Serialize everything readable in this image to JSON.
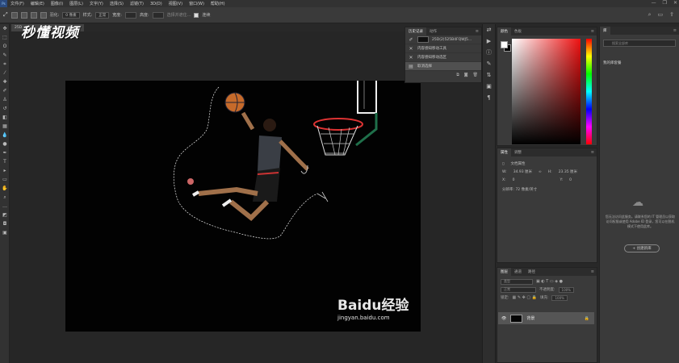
{
  "menubar": {
    "app_icon": "Ps",
    "items": [
      "文件(F)",
      "编辑(E)",
      "图像(I)",
      "图层(L)",
      "文字(Y)",
      "选择(S)",
      "滤镜(T)",
      "3D(D)",
      "视图(V)",
      "窗口(W)",
      "帮助(H)"
    ]
  },
  "options": {
    "feather_label": "羽化:",
    "feather_value": "0 像素",
    "antialias_label": "消除锯齿",
    "style_label": "样式:",
    "style_value": "正常",
    "width_label": "宽度:",
    "height_label": "高度:",
    "mask_label": "选择并遮住...",
    "check_label": "连续"
  },
  "document": {
    "tab_label": "25D"
  },
  "watermark": {
    "top_logo": "秒懂视频",
    "baidu_logo": "Baidu经验",
    "baidu_url": "jingyan.baidu.com"
  },
  "history": {
    "tabs": [
      "历史记录",
      "动作"
    ],
    "rows": [
      {
        "label": "25D(2)525B4FQWJ5...",
        "icon": "snapshot-thumb"
      },
      {
        "label": "内容感知移动工具",
        "icon": "x-icon"
      },
      {
        "label": "内容感知移动选区",
        "icon": "x-icon"
      },
      {
        "label": "取消选择",
        "icon": "doc-icon"
      }
    ]
  },
  "color": {
    "tabs": [
      "颜色",
      "色板"
    ],
    "fg": "#ffffff",
    "bg": "#000000"
  },
  "properties": {
    "tabs": [
      "属性",
      "调整"
    ],
    "title": "文档属性",
    "w_label": "W:",
    "w_value": "34.93 厘米",
    "h_label": "H:",
    "h_value": "23.35 厘米",
    "x_label": "X:",
    "x_value": "0",
    "y_label": "Y:",
    "y_value": "0",
    "res_text": "分辨率: 72 像素/英寸"
  },
  "layers": {
    "tabs": [
      "图层",
      "通道",
      "路径"
    ],
    "kind": "类型",
    "blend": "正常",
    "opacity_label": "不透明度:",
    "opacity_value": "100%",
    "lock_label": "锁定:",
    "fill_label": "填充:",
    "fill_value": "100%",
    "layer_name": "背景"
  },
  "library": {
    "tab": "库",
    "search_placeholder": "搜索全部库",
    "dropdown": "我的库套餐",
    "message": "您无法访问此服务。请联系您的 IT 管理员以获取访问权限或使用 Adobe ID 登录，您可以在脱机模式下使用此库。",
    "button": "+ 创建新库"
  }
}
